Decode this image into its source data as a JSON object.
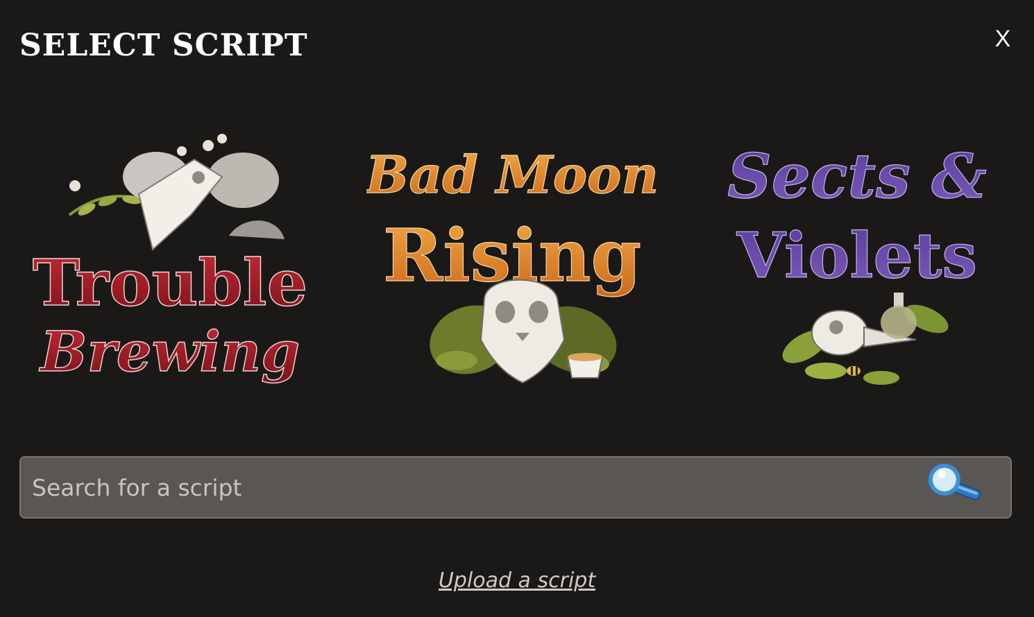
{
  "modal": {
    "title": "SELECT SCRIPT",
    "close_label": "X"
  },
  "scripts": [
    {
      "logo_text": [
        "Trouble",
        "Brewing"
      ],
      "color": "#9e1b24",
      "icon": "ram-skull-icon"
    },
    {
      "logo_text": [
        "Bad Moon",
        "Rising"
      ],
      "color": "#e08a2e",
      "icon": "cat-skull-icon"
    },
    {
      "logo_text": [
        "Sects &",
        "Violets"
      ],
      "color": "#6a4aa8",
      "icon": "bird-skull-icon"
    }
  ],
  "search": {
    "placeholder": "Search for a script",
    "value": ""
  },
  "upload": {
    "label": "Upload a script"
  },
  "colors": {
    "background": "#1b1918",
    "search_field": "#5a5653",
    "magnifier": "#3c8fd6"
  }
}
